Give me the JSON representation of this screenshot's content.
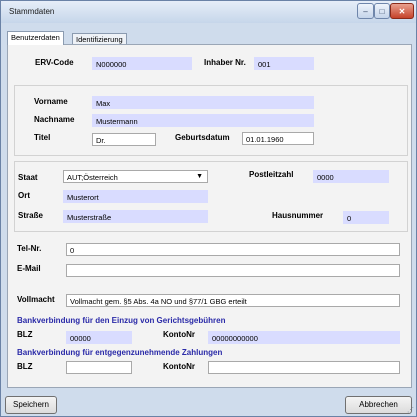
{
  "window": {
    "title": "Stammdaten",
    "controls": {
      "minimize": "–",
      "maximize": "□",
      "close": "✕"
    }
  },
  "tabs": [
    "Benutzerdaten",
    "Identifizierung"
  ],
  "erv": {
    "erv_code_label": "ERV-Code",
    "erv_code_value": "N000000",
    "inhaber_label": "Inhaber Nr.",
    "inhaber_value": "001"
  },
  "person": {
    "vorname_label": "Vorname",
    "vorname_value": "Max",
    "nachname_label": "Nachname",
    "nachname_value": "Mustermann",
    "titel_label": "Titel",
    "titel_value": "Dr.",
    "geburtsdatum_label": "Geburtsdatum",
    "geburtsdatum_value": "01.01.1960"
  },
  "address": {
    "staat_label": "Staat",
    "staat_value": "AUT;Österreich",
    "postleitzahl_label": "Postleitzahl",
    "postleitzahl_value": "0000",
    "ort_label": "Ort",
    "ort_value": "Musterort",
    "strasse_label": "Straße",
    "strasse_value": "Musterstraße",
    "hausnummer_label": "Hausnummer",
    "hausnummer_value": "0"
  },
  "contact": {
    "tel_label": "Tel-Nr.",
    "tel_value": "0",
    "email_label": "E-Mail",
    "email_value": ""
  },
  "vollmacht": {
    "label": "Vollmacht",
    "value": "Vollmacht gem. §5 Abs. 4a NO und §77/1 GBG erteilt"
  },
  "bank_einzug": {
    "heading": "Bankverbindung für den Einzug von Gerichtsgebühren",
    "blz_label": "BLZ",
    "blz_value": "00000",
    "konto_label": "KontoNr",
    "konto_value": "00000000000"
  },
  "bank_zahlungen": {
    "heading": "Bankverbindung für entgegenzunehmende Zahlungen",
    "blz_label": "BLZ",
    "blz_value": "",
    "konto_label": "KontoNr",
    "konto_value": ""
  },
  "buttons": {
    "save": "Speichern",
    "cancel": "Abbrechen"
  },
  "colors": {
    "required_field": "#d9dcff",
    "section_heading": "#2a2aa8",
    "window_frame": "#cfdcec"
  }
}
